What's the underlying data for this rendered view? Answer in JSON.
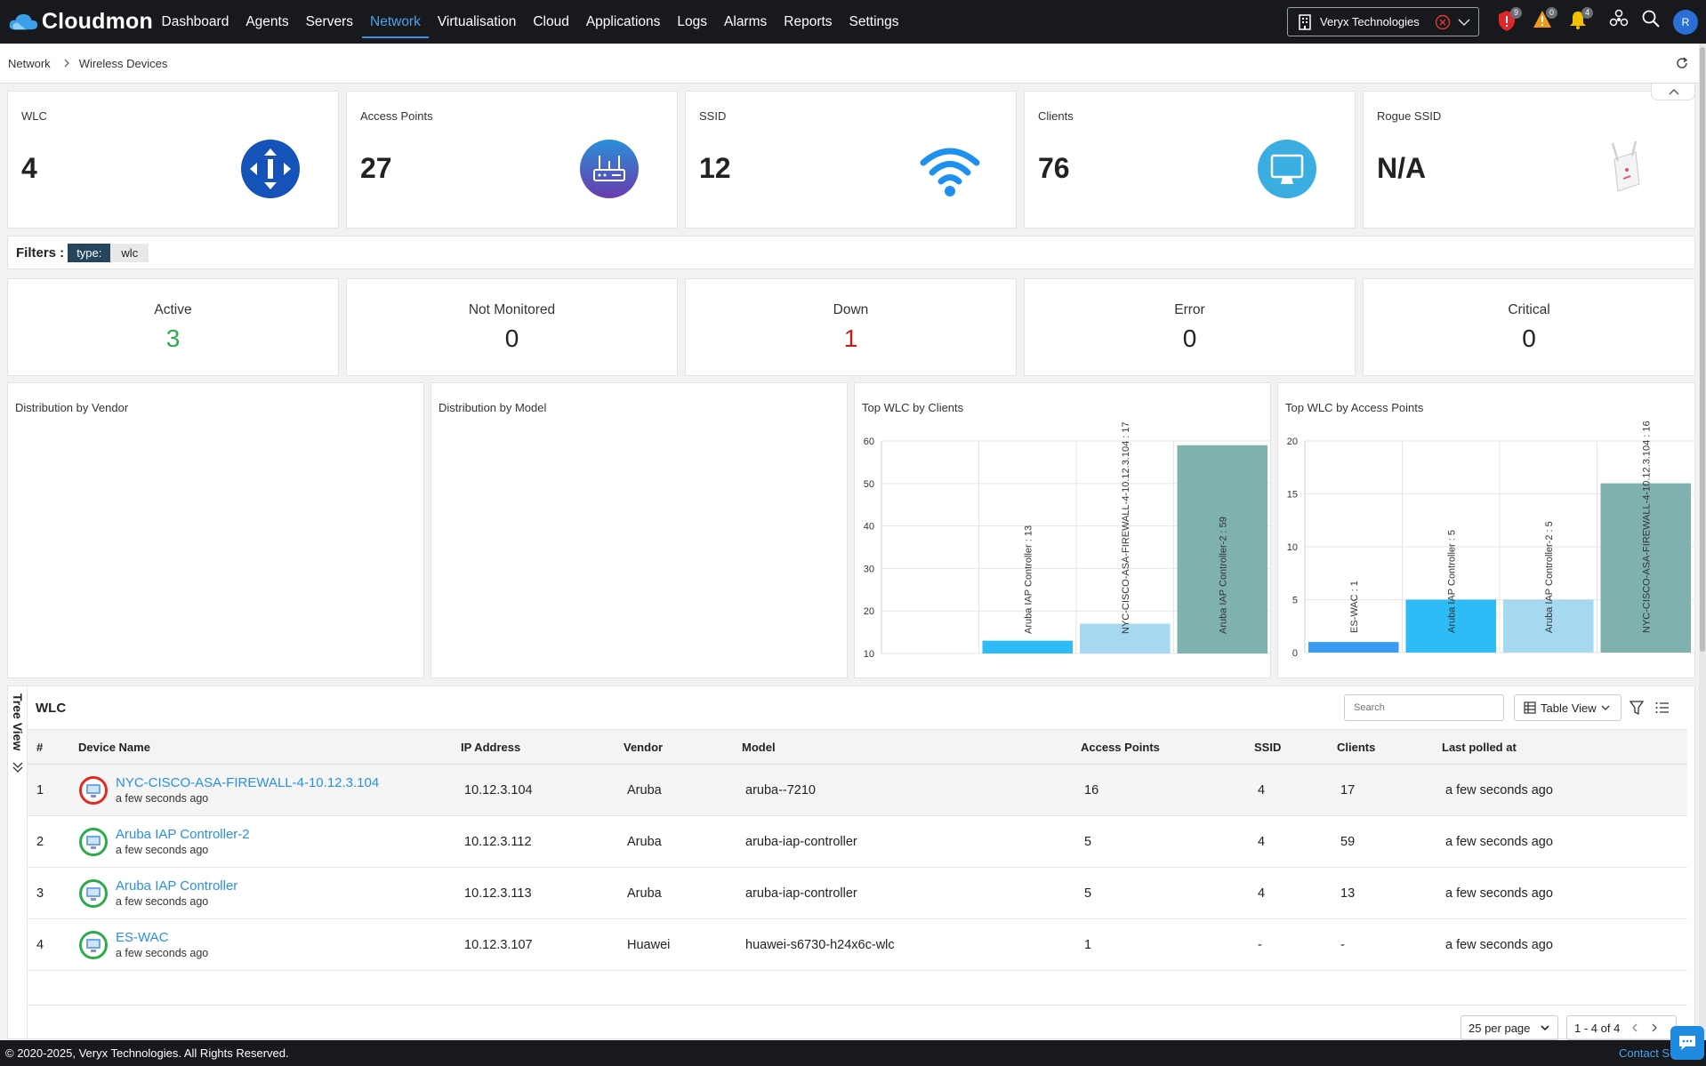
{
  "app": {
    "name": "Cloudmon"
  },
  "nav": [
    "Dashboard",
    "Agents",
    "Servers",
    "Network",
    "Virtualisation",
    "Cloud",
    "Applications",
    "Logs",
    "Alarms",
    "Reports",
    "Settings"
  ],
  "nav_active": "Network",
  "tenant": {
    "name": "Veryx Technologies"
  },
  "top_badges": {
    "security": "9",
    "warnings": "0",
    "notifications": "4"
  },
  "user": {
    "initial": "R"
  },
  "breadcrumb": {
    "root": "Network",
    "current": "Wireless Devices"
  },
  "kpis": [
    {
      "title": "WLC",
      "value": "4",
      "icon": "wlc-icon"
    },
    {
      "title": "Access Points",
      "value": "27",
      "icon": "router-icon"
    },
    {
      "title": "SSID",
      "value": "12",
      "icon": "wifi-icon"
    },
    {
      "title": "Clients",
      "value": "76",
      "icon": "monitor-icon"
    },
    {
      "title": "Rogue SSID",
      "value": "N/A",
      "icon": "rogue-ap-icon"
    }
  ],
  "filters": {
    "label": "Filters :",
    "key": "type:",
    "value": "wlc"
  },
  "status": [
    {
      "title": "Active",
      "value": "3",
      "color": "#2eaa4e"
    },
    {
      "title": "Not Monitored",
      "value": "0",
      "color": "#222222"
    },
    {
      "title": "Down",
      "value": "1",
      "color": "#c0201a"
    },
    {
      "title": "Error",
      "value": "0",
      "color": "#222222"
    },
    {
      "title": "Critical",
      "value": "0",
      "color": "#222222"
    }
  ],
  "panels": {
    "vendor": "Distribution by Vendor",
    "model": "Distribution by Model"
  },
  "chart_data": [
    {
      "type": "bar",
      "title": "Top WLC by Clients",
      "categories": [
        "Aruba IAP Controller",
        "NYC-CISCO-ASA-FIREWALL-4-10.12.3.104",
        "Aruba IAP Controller-2"
      ],
      "values": [
        13,
        17,
        59
      ],
      "data_labels": [
        "Aruba IAP Controller : 13",
        "NYC-CISCO-ASA-FIREWALL-4-10.12.3.104 : 17",
        "Aruba IAP Controller-2 : 59"
      ],
      "yticks": [
        "10",
        "20",
        "30",
        "40",
        "50",
        "60"
      ],
      "ylim": [
        10,
        60
      ],
      "colors": [
        "#2dbcf5",
        "#a6d8f0",
        "#7fb1ae"
      ],
      "grid": true
    },
    {
      "type": "bar",
      "title": "Top WLC by Access Points",
      "categories": [
        "ES-WAC",
        "Aruba IAP Controller",
        "Aruba IAP Controller-2",
        "NYC-CISCO-ASA-FIREWALL-4-10.12.3.104"
      ],
      "values": [
        1,
        5,
        5,
        16
      ],
      "data_labels": [
        "ES-WAC : 1",
        "Aruba IAP Controller : 5",
        "Aruba IAP Controller-2 : 5",
        "NYC-CISCO-ASA-FIREWALL-4-10.12.3.104 : 16"
      ],
      "yticks": [
        "0",
        "5",
        "10",
        "15",
        "20"
      ],
      "ylim": [
        0,
        20
      ],
      "colors": [
        "#3a9bf0",
        "#2dbcf5",
        "#a6d8f0",
        "#7fb1ae"
      ],
      "grid": true
    }
  ],
  "table": {
    "title": "WLC",
    "tree_view_label": "Tree View",
    "search_placeholder": "Search",
    "view_label": "Table View",
    "columns": [
      "#",
      "Device Name",
      "IP Address",
      "Vendor",
      "Model",
      "Access Points",
      "SSID",
      "Clients",
      "Last polled at"
    ],
    "rows": [
      {
        "num": "1",
        "name": "NYC-CISCO-ASA-FIREWALL-4-10.12.3.104",
        "sub": "a few seconds ago",
        "ip": "10.12.3.104",
        "vendor": "Aruba",
        "model": "aruba--7210",
        "ap": "16",
        "ssid": "4",
        "clients": "17",
        "polled": "a few seconds ago",
        "status_color": "#e02b20"
      },
      {
        "num": "2",
        "name": "Aruba IAP Controller-2",
        "sub": "a few seconds ago",
        "ip": "10.12.3.112",
        "vendor": "Aruba",
        "model": "aruba-iap-controller",
        "ap": "5",
        "ssid": "4",
        "clients": "59",
        "polled": "a few seconds ago",
        "status_color": "#2eaa4e"
      },
      {
        "num": "3",
        "name": "Aruba IAP Controller",
        "sub": "a few seconds ago",
        "ip": "10.12.3.113",
        "vendor": "Aruba",
        "model": "aruba-iap-controller",
        "ap": "5",
        "ssid": "4",
        "clients": "13",
        "polled": "a few seconds ago",
        "status_color": "#2eaa4e"
      },
      {
        "num": "4",
        "name": "ES-WAC",
        "sub": "a few seconds ago",
        "ip": "10.12.3.107",
        "vendor": "Huawei",
        "model": "huawei-s6730-h24x6c-wlc",
        "ap": "1",
        "ssid": "-",
        "clients": "-",
        "polled": "a few seconds ago",
        "status_color": "#2eaa4e"
      }
    ],
    "per_page": "25 per page",
    "range": "1 - 4 of 4"
  },
  "footer": {
    "copyright": "© 2020-2025, Veryx Technologies. All Rights Reserved.",
    "contact": "Contact S"
  }
}
